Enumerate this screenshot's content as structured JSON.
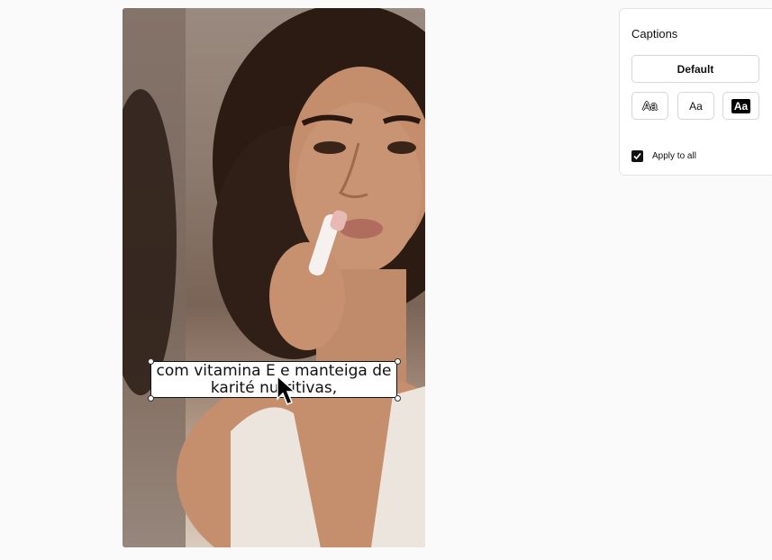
{
  "video": {
    "caption_lines": [
      "com vitamina E e manteiga de",
      "karité nutritivas,"
    ]
  },
  "captions_panel": {
    "title": "Captions",
    "preset_button": "Default",
    "style_buttons": [
      {
        "label": "Aa",
        "style": "outline"
      },
      {
        "label": "Aa",
        "style": "plain"
      },
      {
        "label": "Aa",
        "style": "filled"
      }
    ],
    "apply_to_all": {
      "label": "Apply to all",
      "checked": true
    }
  },
  "colors": {
    "background": "#fafafa",
    "panel": "#ffffff",
    "accent": "#111111"
  },
  "icons": [
    "check-icon",
    "mouse-pointer-icon"
  ]
}
